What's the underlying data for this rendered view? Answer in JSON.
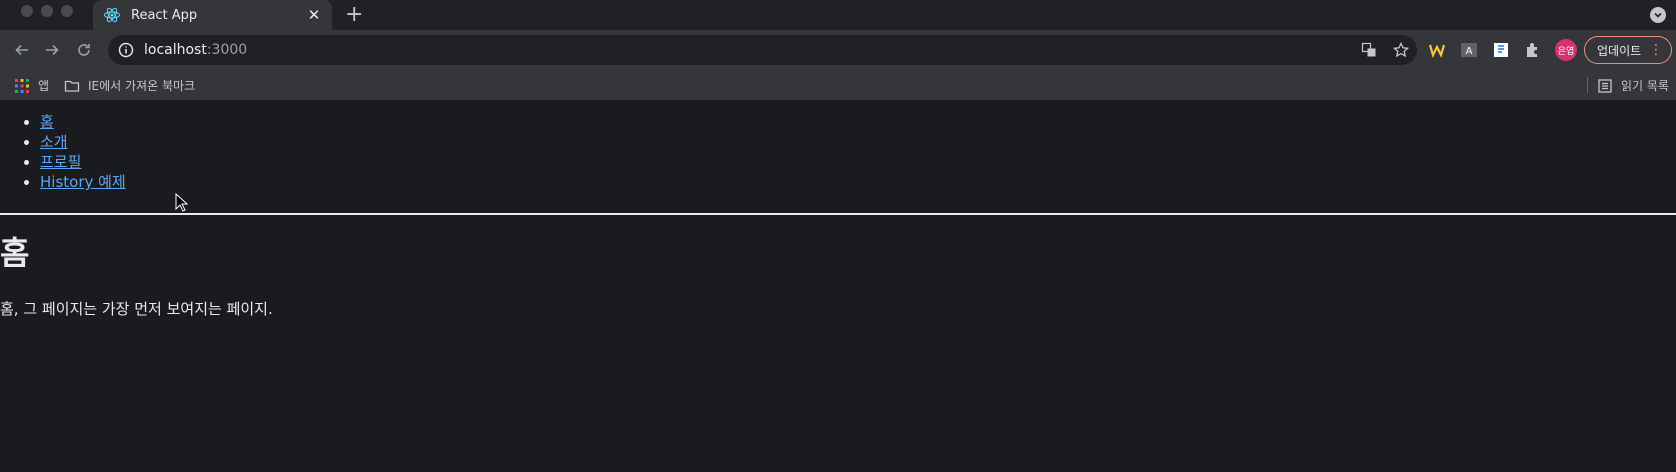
{
  "browser": {
    "tab": {
      "title": "React App"
    },
    "address": {
      "host": "localhost",
      "port": ":3000"
    },
    "bookmarks": {
      "apps": "앱",
      "folder": "IE에서 가져온 북마크",
      "reading_list": "읽기 목록"
    },
    "profile_initials": "은엽",
    "update_label": "업데이트"
  },
  "nav": {
    "items": [
      {
        "label": "홈"
      },
      {
        "label": "소개"
      },
      {
        "label": "프로필"
      },
      {
        "label": "History 예제"
      }
    ]
  },
  "main": {
    "heading": "홈",
    "description": "홈, 그 페이지는 가장 먼저 보여지는 페이지."
  },
  "colors": {
    "link": "#5ea3f5",
    "page_bg": "#1a1b1e",
    "accent_update": "#f28b82",
    "profile": "#d6336c"
  }
}
